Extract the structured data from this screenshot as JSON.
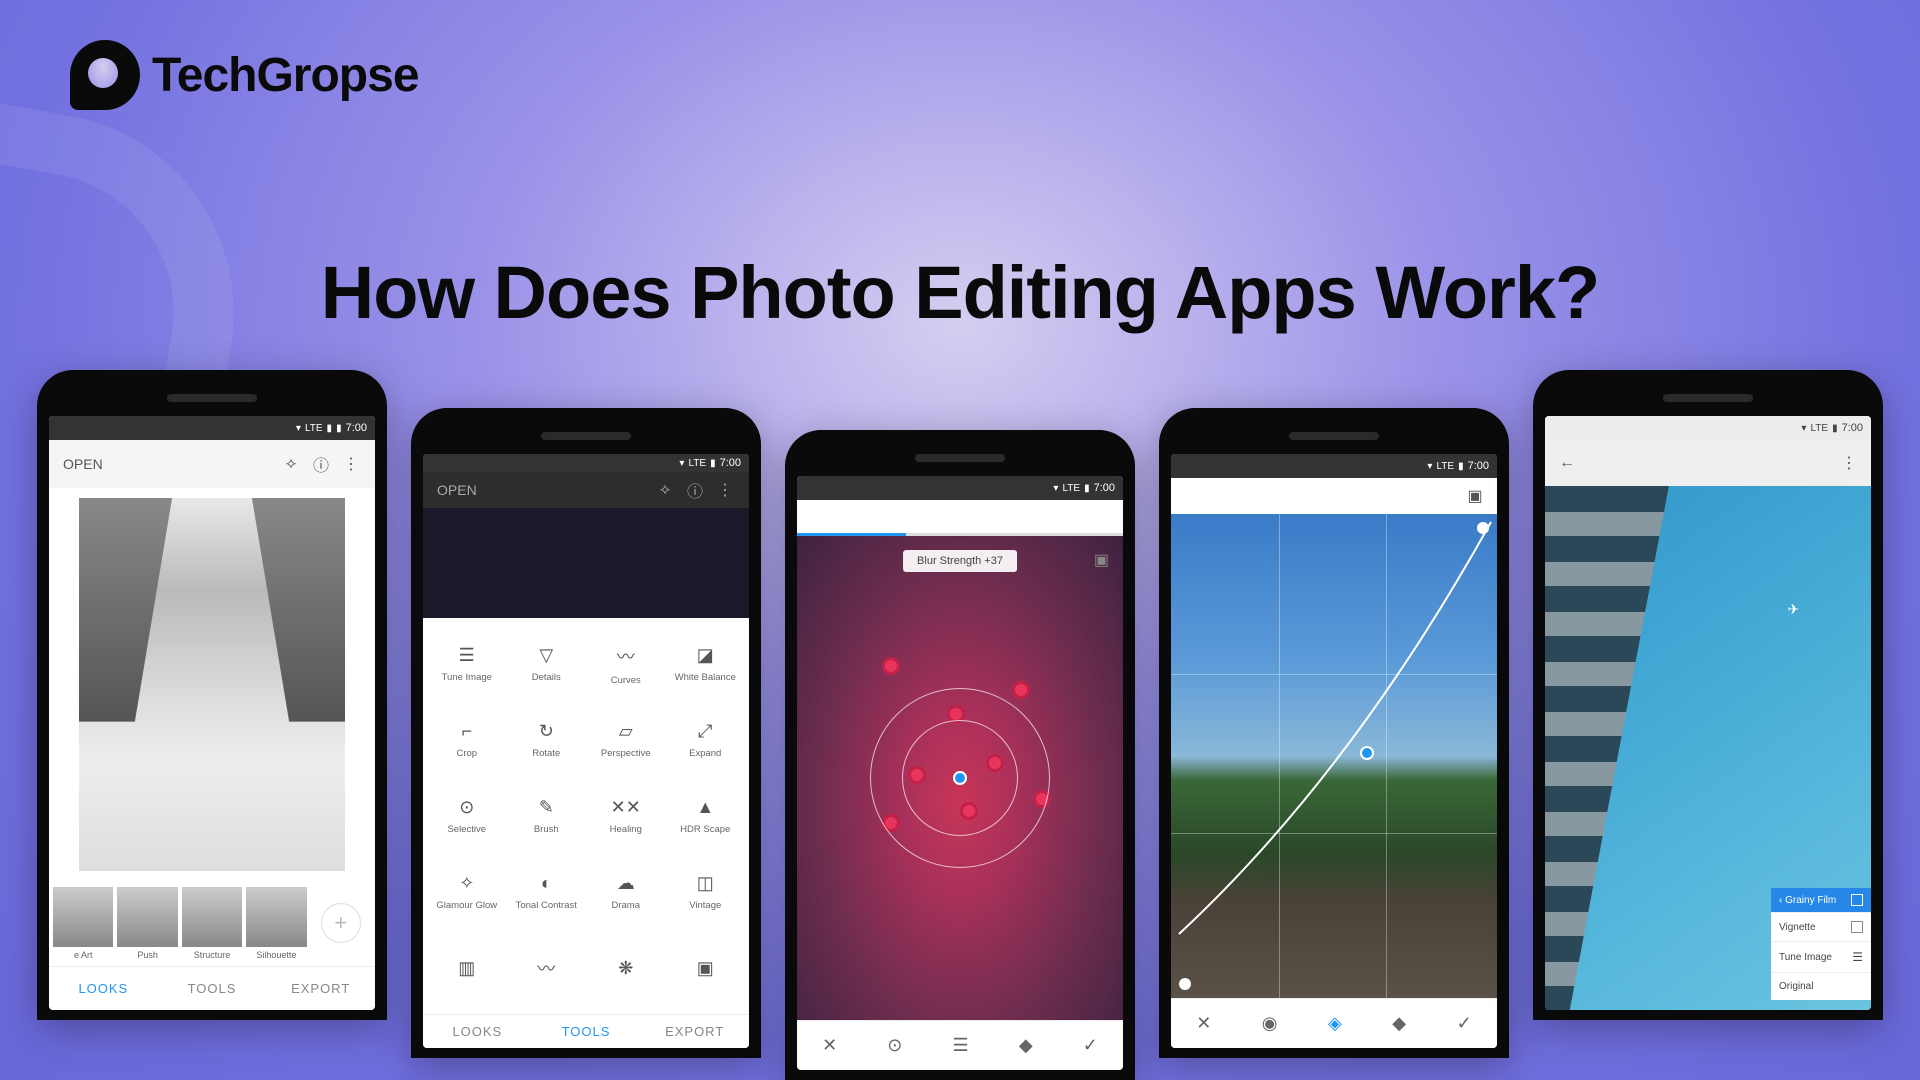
{
  "brand": "TechGropse",
  "title": "How Does Photo Editing Apps Work?",
  "status_time": "7:00",
  "status_signal": "LTE",
  "phone1": {
    "open_label": "OPEN",
    "filters": [
      "e Art",
      "Push",
      "Structure",
      "Silhouette"
    ],
    "tabs": {
      "looks": "LOOKS",
      "tools": "TOOLS",
      "export": "EXPORT"
    },
    "active_tab": "looks"
  },
  "phone2": {
    "open_label": "OPEN",
    "tools": [
      "Tune Image",
      "Details",
      "Curves",
      "White Balance",
      "Crop",
      "Rotate",
      "Perspective",
      "Expand",
      "Selective",
      "Brush",
      "Healing",
      "HDR Scape",
      "Glamour Glow",
      "Tonal Contrast",
      "Drama",
      "Vintage"
    ],
    "tool_icons": [
      "☰",
      "▽",
      "〰",
      "◪",
      "⌐",
      "↻",
      "▱",
      "⤢",
      "⊙",
      "✎",
      "✕✕",
      "▲",
      "✧",
      "◐",
      "☁",
      "◫"
    ],
    "extra_row_icons": [
      "▥",
      "〰",
      "❋",
      "▣"
    ],
    "tabs": {
      "looks": "LOOKS",
      "tools": "TOOLS",
      "export": "EXPORT"
    },
    "active_tab": "tools"
  },
  "phone3": {
    "chip": "Blur Strength +37",
    "actions": [
      "✕",
      "⊙",
      "☰",
      "◆",
      "✓"
    ]
  },
  "phone4": {
    "actions": [
      "✕",
      "◉",
      "◈",
      "◆",
      "✓"
    ]
  },
  "phone5": {
    "filters_header": "Grainy Film",
    "filters": [
      "Vignette",
      "Tune Image",
      "Original"
    ]
  }
}
